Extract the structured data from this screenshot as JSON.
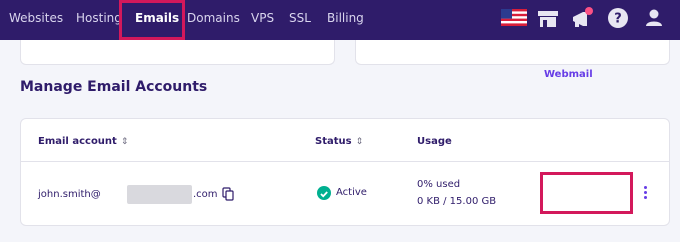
{
  "nav": {
    "items": [
      "Websites",
      "Hosting",
      "Emails",
      "Domains",
      "VPS",
      "SSL",
      "Billing"
    ],
    "active": "Emails"
  },
  "icons": [
    "us-flag-icon",
    "store-icon",
    "megaphone-icon",
    "help-icon",
    "user-icon"
  ],
  "section": {
    "title": "Manage Email Accounts"
  },
  "table": {
    "headers": {
      "email": "Email account",
      "status": "Status",
      "usage": "Usage"
    },
    "row": {
      "email_prefix": "john.smith@",
      "email_suffix": ".com",
      "status": "Active",
      "usage_percent": "0% used",
      "usage_amount": "0 KB / 15.00 GB",
      "action": "Webmail"
    }
  },
  "colors": {
    "topbar": "#2f1c6a",
    "highlight": "#d3185b",
    "active_status": "#00b090",
    "link": "#673de6"
  }
}
